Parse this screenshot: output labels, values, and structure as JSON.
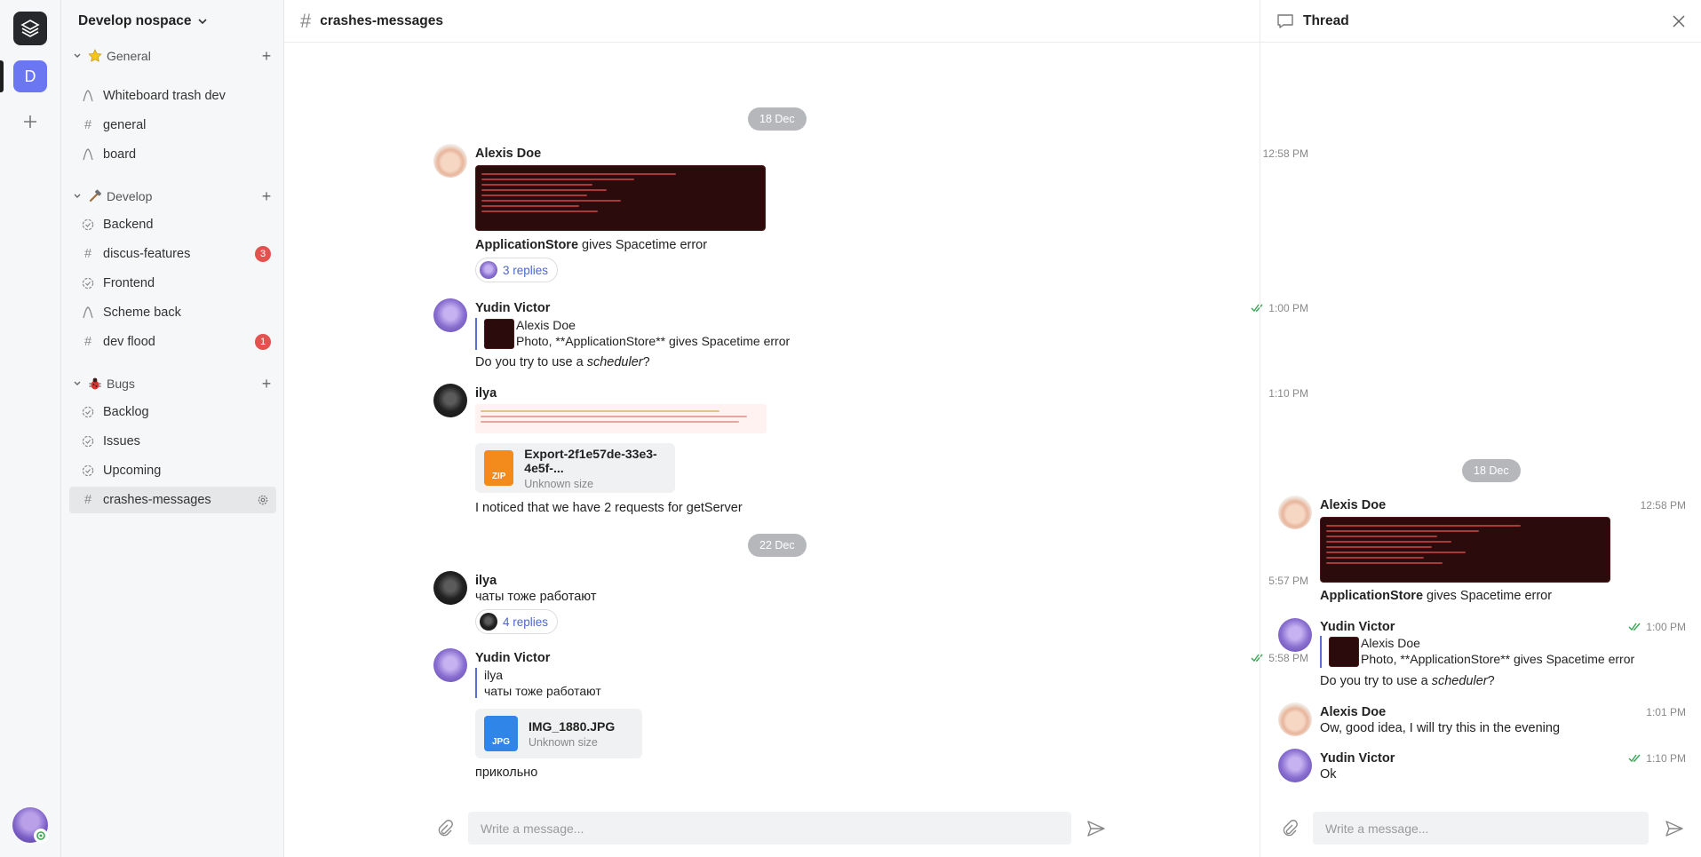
{
  "rail": {
    "workspace_initial": "D",
    "colors": {
      "workspace": "#6b76f2",
      "rail_bg": "#f6f7f8"
    }
  },
  "sidebar": {
    "workspace_name": "Develop nospace",
    "groups": [
      {
        "name": "General",
        "emoji": "star-icon",
        "channels": [
          {
            "label": "Whiteboard trash dev",
            "icon": "whiteboard-icon"
          },
          {
            "label": "general",
            "icon": "hash-icon"
          },
          {
            "label": "board",
            "icon": "whiteboard-icon"
          }
        ]
      },
      {
        "name": "Develop",
        "emoji": "hammer-icon",
        "channels": [
          {
            "label": "Backend",
            "icon": "tracker-icon"
          },
          {
            "label": "discus-features",
            "icon": "hash-icon",
            "badge": "3"
          },
          {
            "label": "Frontend",
            "icon": "tracker-icon"
          },
          {
            "label": "Scheme back",
            "icon": "whiteboard-icon"
          },
          {
            "label": "dev flood",
            "icon": "hash-icon",
            "badge": "1"
          }
        ]
      },
      {
        "name": "Bugs",
        "emoji": "bug-icon",
        "channels": [
          {
            "label": "Backlog",
            "icon": "tracker-icon"
          },
          {
            "label": "Issues",
            "icon": "tracker-icon"
          },
          {
            "label": "Upcoming",
            "icon": "tracker-icon"
          },
          {
            "label": "crashes-messages",
            "icon": "hash-icon",
            "active": true
          }
        ]
      }
    ]
  },
  "main": {
    "channel_title": "crashes-messages",
    "dates": [
      "18 Dec",
      "22 Dec"
    ],
    "messages": [
      {
        "author": "Alexis Doe",
        "time": "12:58 PM",
        "caption_bold": "ApplicationStore",
        "caption_rest": " gives Spacetime error",
        "replies": "3 replies"
      },
      {
        "author": "Yudin Victor",
        "time": "1:00 PM",
        "quote_author": "Alexis Doe",
        "quote_text": "Photo, **ApplicationStore** gives Spacetime error",
        "text_pre": "Do you try to use a ",
        "text_em": "scheduler",
        "text_post": "?"
      },
      {
        "author": "ilya",
        "time": "1:10 PM",
        "file_name": "Export-2f1e57de-33e3-4e5f-...",
        "file_size": "Unknown size",
        "file_type": "ZIP",
        "text": "I noticed that we have 2 requests for getServer"
      },
      {
        "author": "ilya",
        "time": "5:57 PM",
        "text": "чаты тоже работают",
        "replies": "4 replies"
      },
      {
        "author": "Yudin Victor",
        "time": "5:58 PM",
        "quote_author": "ilya",
        "quote_text": "чаты тоже работают",
        "file_name": "IMG_1880.JPG",
        "file_size": "Unknown size",
        "file_type": "JPG",
        "text": "прикольно"
      }
    ],
    "composer_placeholder": "Write a message..."
  },
  "thread": {
    "title": "Thread",
    "date": "18 Dec",
    "messages": [
      {
        "author": "Alexis Doe",
        "time": "12:58 PM",
        "caption_bold": "ApplicationStore",
        "caption_rest": " gives Spacetime error"
      },
      {
        "author": "Yudin Victor",
        "time": "1:00 PM",
        "quote_author": "Alexis Doe",
        "quote_text": "Photo, **ApplicationStore** gives Spacetime error",
        "text_pre": "Do you try to use a ",
        "text_em": "scheduler",
        "text_post": "?"
      },
      {
        "author": "Alexis Doe",
        "time": "1:01 PM",
        "text": "Ow, good idea, I will try this in the evening"
      },
      {
        "author": "Yudin Victor",
        "time": "1:10 PM",
        "text": "Ok"
      }
    ],
    "composer_placeholder": "Write a message..."
  },
  "colors": {
    "accent": "#4c68c9",
    "badge": "#e2524f",
    "read_check": "#3aa655",
    "date_pill": "#b5b7ba",
    "zip": "#f28a1c",
    "jpg": "#2f86e8"
  }
}
